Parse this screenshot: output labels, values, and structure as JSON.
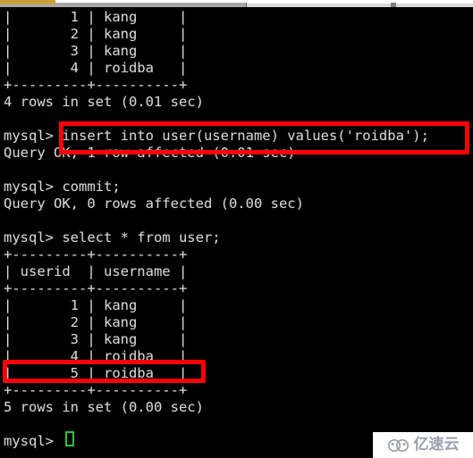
{
  "window": {
    "background_color": "#000000",
    "text_color": "#d6d6d6",
    "accent_color": "#fb0005",
    "cursor_color": "#35c23a",
    "scrollbar_gold": "#c8a13c"
  },
  "terminal": {
    "lines": [
      "|       1 | kang     |",
      "|       2 | kang     |",
      "|       3 | kang     |",
      "|       4 | roidba   |",
      "+---------+----------+",
      "4 rows in set (0.01 sec)",
      "",
      "mysql> insert into user(username) values('roidba');",
      "Query OK, 1 row affected (0.01 sec)",
      "",
      "mysql> commit;",
      "Query OK, 0 rows affected (0.00 sec)",
      "",
      "mysql> select * from user;",
      "+---------+----------+",
      "| userid  | username |",
      "+---------+----------+",
      "|       1 | kang     |",
      "|       2 | kang     |",
      "|       3 | kang     |",
      "|       4 | roidba   |",
      "|       5 | roidba   |",
      "+---------+----------+",
      "5 rows in set (0.00 sec)",
      "",
      "mysql> "
    ]
  },
  "annotations": {
    "insert_statement_highlight": "insert into user(username) values('roidba');",
    "inserted_row_highlight": "|       5 | roidba   |"
  },
  "watermark": {
    "text": "亿速云",
    "logo_icon": "cloud-icon"
  }
}
